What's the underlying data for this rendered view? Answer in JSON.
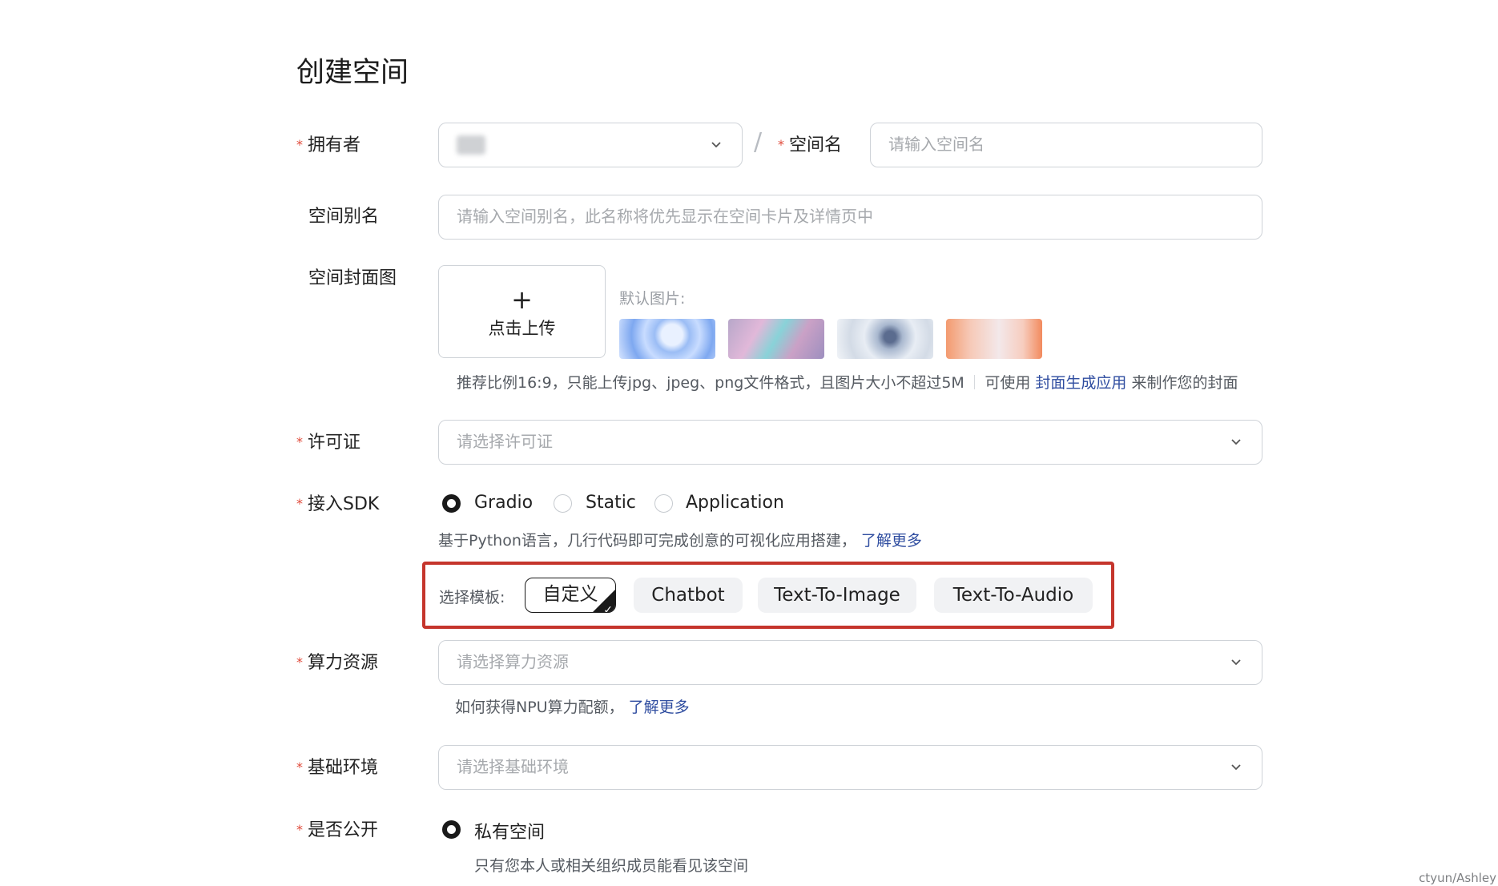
{
  "page": {
    "title": "创建空间"
  },
  "owner": {
    "label": "拥有者",
    "value": ""
  },
  "space_name": {
    "label": "空间名",
    "placeholder": "请输入空间名"
  },
  "alias": {
    "label": "空间别名",
    "placeholder": "请输入空间别名，此名称将优先显示在空间卡片及详情页中"
  },
  "cover": {
    "label": "空间封面图",
    "upload_label": "点击上传",
    "default_label": "默认图片:",
    "hint": "推荐比例16:9，只能上传jpg、jpeg、png文件格式，且图片大小不超过5M",
    "hint_prefix": "可使用",
    "hint_link": "封面生成应用",
    "hint_suffix": "来制作您的封面"
  },
  "license": {
    "label": "许可证",
    "placeholder": "请选择许可证"
  },
  "sdk": {
    "label": "接入SDK",
    "options": [
      "Gradio",
      "Static",
      "Application"
    ],
    "selected": "Gradio",
    "description": "基于Python语言，几行代码即可完成创意的可视化应用搭建，",
    "learn_more": "了解更多"
  },
  "template": {
    "label": "选择模板:",
    "options": [
      "自定义",
      "Chatbot",
      "Text-To-Image",
      "Text-To-Audio"
    ],
    "selected": "自定义"
  },
  "compute": {
    "label": "算力资源",
    "placeholder": "请选择算力资源",
    "hint": "如何获得NPU算力配额，",
    "learn_more": "了解更多"
  },
  "environment": {
    "label": "基础环境",
    "placeholder": "请选择基础环境"
  },
  "visibility": {
    "label": "是否公开",
    "option": "私有空间",
    "description": "只有您本人或相关组织成员能看见该空间"
  },
  "watermark": "ctyun/Ashley",
  "colors": {
    "required_star": "#e04a3a",
    "link": "#2f4da0",
    "highlight_border": "#c5352c"
  }
}
